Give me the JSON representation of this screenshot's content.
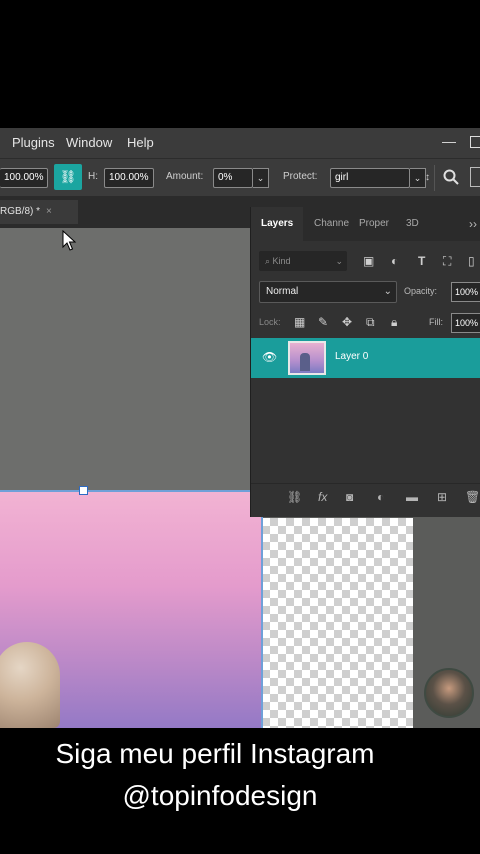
{
  "menu": {
    "items": [
      "Plugins",
      "Window",
      "Help"
    ],
    "minimize": "—"
  },
  "options": {
    "w_value": "100.00%",
    "link_icon": "link-icon",
    "h_label": "H:",
    "h_value": "100.00%",
    "amount_label": "Amount:",
    "amount_value": "0%",
    "protect_label": "Protect:",
    "protect_value": "girl"
  },
  "document": {
    "tab_label": "RGB/8) *",
    "close": "×"
  },
  "layers_panel": {
    "tabs": [
      "Layers",
      "Channe",
      "Proper",
      "3D"
    ],
    "more": "››",
    "kind_placeholder": "Kind",
    "blend_mode": "Normal",
    "opacity_label": "Opacity:",
    "opacity_value": "100%",
    "lock_label": "Lock:",
    "fill_label": "Fill:",
    "fill_value": "100%",
    "layers": [
      {
        "name": "Layer 0",
        "visible": true,
        "selected": true
      }
    ]
  },
  "colors": {
    "accent": "#1a9d9b",
    "selection": "#6fa0d8"
  },
  "caption": {
    "line1": "Siga meu perfil Instagram",
    "line2": "@topinfodesign"
  }
}
